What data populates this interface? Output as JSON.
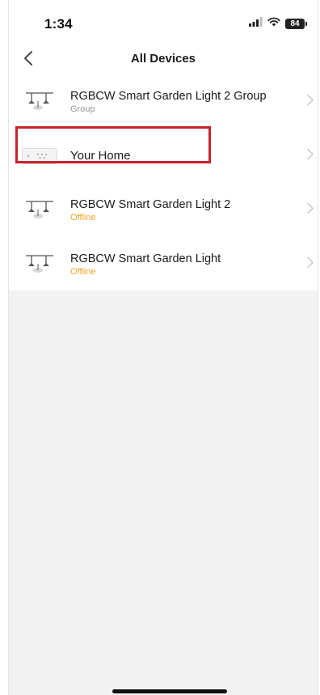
{
  "status_bar": {
    "time": "1:34",
    "battery": "84"
  },
  "nav": {
    "title": "All Devices",
    "back_icon": "chevron-left-icon"
  },
  "devices": [
    {
      "name": "RGBCW Smart Garden Light 2 Group",
      "subtitle": "Group",
      "icon": "garden-light-icon",
      "subtitle_color": "#9a9a9a"
    },
    {
      "name": "Your Home",
      "subtitle": "",
      "icon": "switch-panel-icon",
      "highlighted": true,
      "highlight_color": "#c8232b"
    },
    {
      "name": "RGBCW Smart Garden Light 2",
      "subtitle": "Offline",
      "icon": "garden-light-icon",
      "subtitle_color": "#f0a628"
    },
    {
      "name": "RGBCW Smart Garden Light",
      "subtitle": "Offline",
      "icon": "garden-light-icon",
      "subtitle_color": "#f0a628"
    }
  ],
  "colors": {
    "background_lower": "#f2f2f2",
    "offline": "#f0a628",
    "highlight": "#c8232b"
  }
}
